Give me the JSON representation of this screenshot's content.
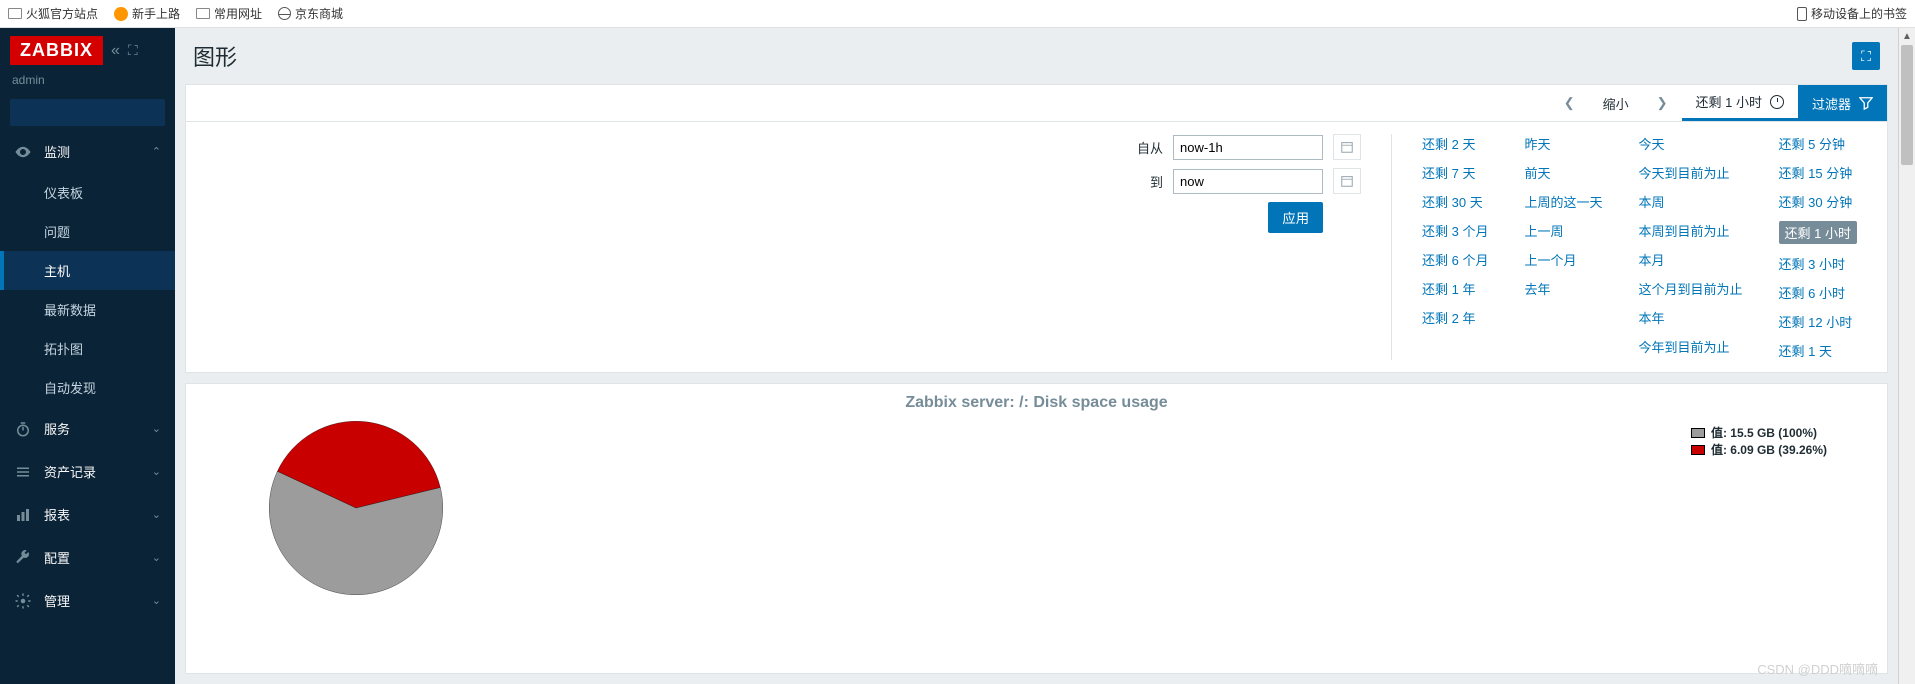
{
  "browser_bookmarks": {
    "left": [
      "火狐官方站点",
      "新手上路",
      "常用网址",
      "京东商城"
    ],
    "right": "移动设备上的书签"
  },
  "sidebar": {
    "logo": "ZABBIX",
    "user": "admin",
    "sections": {
      "monitoring": {
        "label": "监测",
        "expanded": true
      },
      "services": {
        "label": "服务"
      },
      "inventory": {
        "label": "资产记录"
      },
      "reports": {
        "label": "报表"
      },
      "config": {
        "label": "配置"
      },
      "admin": {
        "label": "管理"
      }
    },
    "monitoring_items": [
      "仪表板",
      "问题",
      "主机",
      "最新数据",
      "拓扑图",
      "自动发现"
    ],
    "active_item": "主机"
  },
  "page": {
    "title": "图形"
  },
  "filter_tabs": {
    "zoom_out": "缩小",
    "range_label": "还剩 1 小时",
    "filter_label": "过滤器"
  },
  "time_form": {
    "from_label": "自从",
    "from_value": "now-1h",
    "to_label": "到",
    "to_value": "now",
    "apply": "应用"
  },
  "quick_ranges": {
    "col1": [
      "还剩 2 天",
      "还剩 7 天",
      "还剩 30 天",
      "还剩 3 个月",
      "还剩 6 个月",
      "还剩 1 年",
      "还剩 2 年"
    ],
    "col2": [
      "昨天",
      "前天",
      "上周的这一天",
      "上一周",
      "上一个月",
      "去年"
    ],
    "col3": [
      "今天",
      "今天到目前为止",
      "本周",
      "本周到目前为止",
      "本月",
      "这个月到目前为止",
      "本年",
      "今年到目前为止"
    ],
    "col4": [
      "还剩 5 分钟",
      "还剩 15 分钟",
      "还剩 30 分钟",
      "还剩 1 小时",
      "还剩 3 小时",
      "还剩 6 小时",
      "还剩 12 小时",
      "还剩 1 天"
    ],
    "selected": "还剩 1 小时"
  },
  "chart_data": {
    "type": "pie",
    "title": "Zabbix server: /: Disk space usage",
    "series": [
      {
        "name": "值",
        "value_label": "15.5 GB",
        "percent": 100,
        "color": "#9c9c9c"
      },
      {
        "name": "值",
        "value_label": "6.09 GB",
        "percent": 39.26,
        "color": "#c80000"
      }
    ],
    "legend": [
      "值: 15.5 GB (100%)",
      "值: 6.09 GB (39.26%)"
    ]
  },
  "watermark": "CSDN @DDD嘀嘀嘀"
}
